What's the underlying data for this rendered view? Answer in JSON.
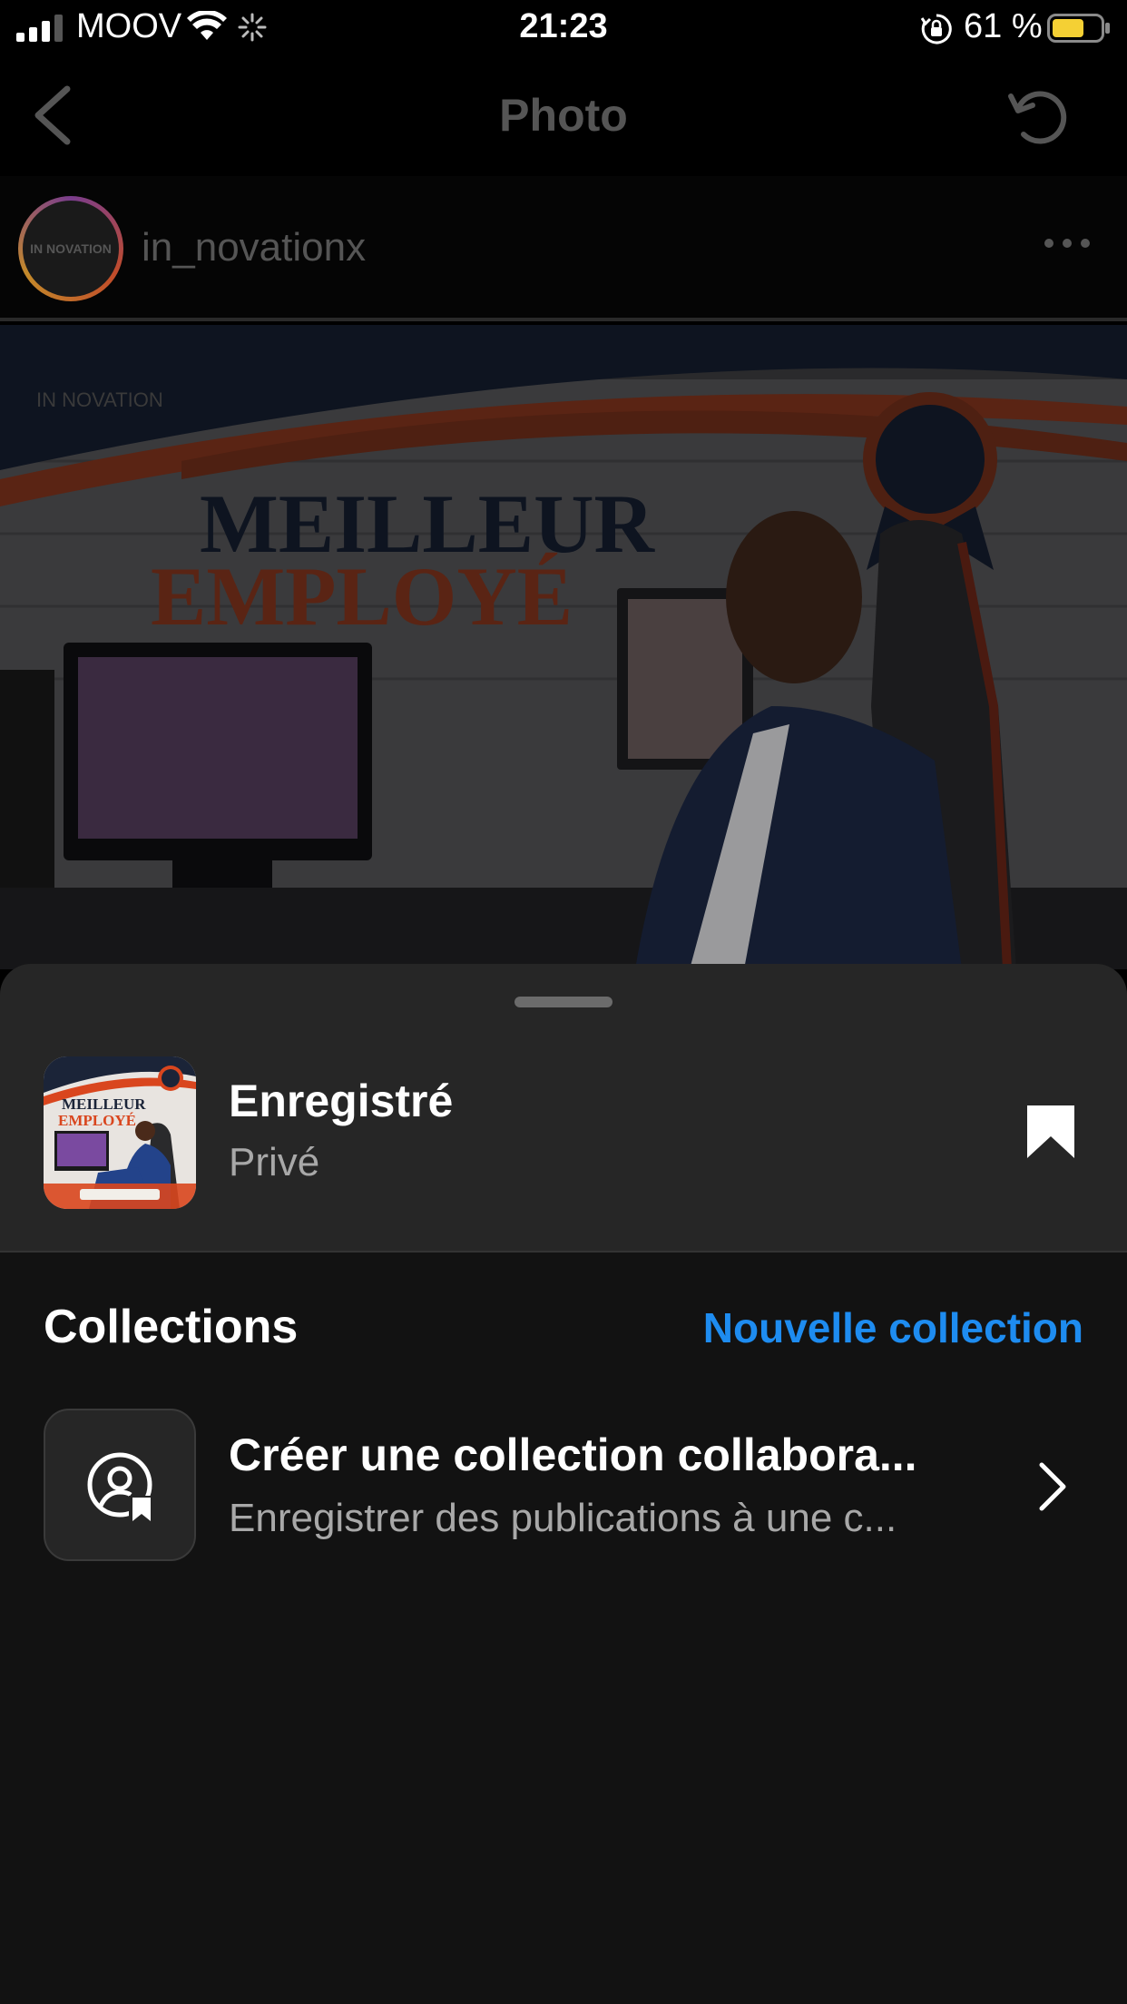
{
  "status_bar": {
    "carrier": "MOOV",
    "time": "21:23",
    "battery_percent": "61 %"
  },
  "nav": {
    "title": "Photo"
  },
  "post": {
    "username": "in_novationx",
    "image_text": {
      "headline_1": "MEILLEUR",
      "headline_2": "EMPLOYÉ",
      "logo": "IN NOVATION"
    }
  },
  "sheet": {
    "saved": {
      "title": "Enregistré",
      "subtitle": "Privé"
    },
    "collections_title": "Collections",
    "new_collection_label": "Nouvelle collection",
    "collab": {
      "title": "Créer une collection collabora...",
      "subtitle": "Enregistrer des publications à une c..."
    }
  },
  "colors": {
    "accent": "#1e8cf0",
    "sheet_bg": "#121212",
    "sheet_top_bg": "#262626"
  },
  "icons": [
    "signal-icon",
    "wifi-icon",
    "spinner-icon",
    "orientation-lock-icon",
    "battery-icon",
    "back-chevron-icon",
    "refresh-icon",
    "more-dots-icon",
    "bookmark-icon",
    "collab-collection-icon",
    "chevron-right-icon"
  ]
}
